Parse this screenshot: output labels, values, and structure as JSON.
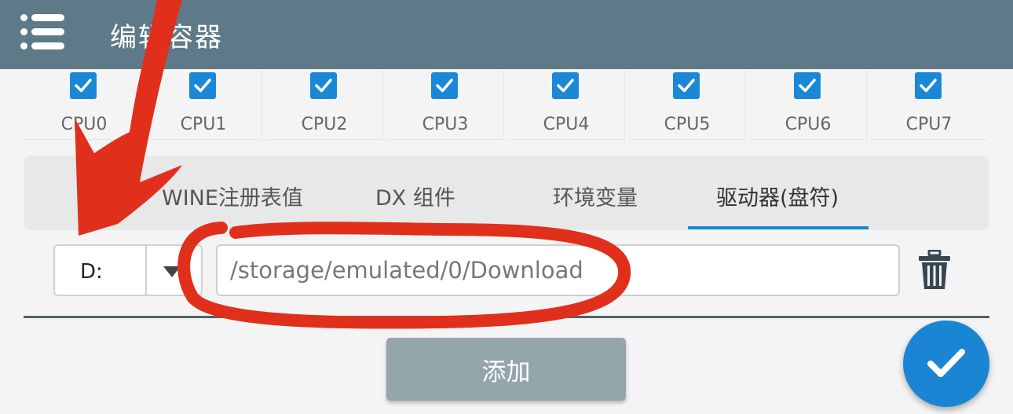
{
  "app_bar": {
    "title": "编辑容器"
  },
  "cpus": [
    {
      "label": "CPU0",
      "checked": true
    },
    {
      "label": "CPU1",
      "checked": true
    },
    {
      "label": "CPU2",
      "checked": true
    },
    {
      "label": "CPU3",
      "checked": true
    },
    {
      "label": "CPU4",
      "checked": true
    },
    {
      "label": "CPU5",
      "checked": true
    },
    {
      "label": "CPU6",
      "checked": true
    },
    {
      "label": "CPU7",
      "checked": true
    }
  ],
  "tabs": [
    {
      "label": "WINE注册表值",
      "active": false
    },
    {
      "label": "DX 组件",
      "active": false
    },
    {
      "label": "环境变量",
      "active": false
    },
    {
      "label": "驱动器(盘符)",
      "active": true
    }
  ],
  "drive": {
    "letter": "D:",
    "path_value": "/storage/emulated/0/Download"
  },
  "actions": {
    "add_label": "添加"
  },
  "colors": {
    "app_bar": "#5e7a89",
    "accent": "#1a88d6",
    "annotation": "#e0301c",
    "add_button": "#94a5ab"
  },
  "icons": {
    "menu": "menu-icon",
    "checkbox": "check-icon",
    "dropdown": "caret-down-icon",
    "delete": "trash-icon",
    "confirm": "checkmark-icon"
  }
}
